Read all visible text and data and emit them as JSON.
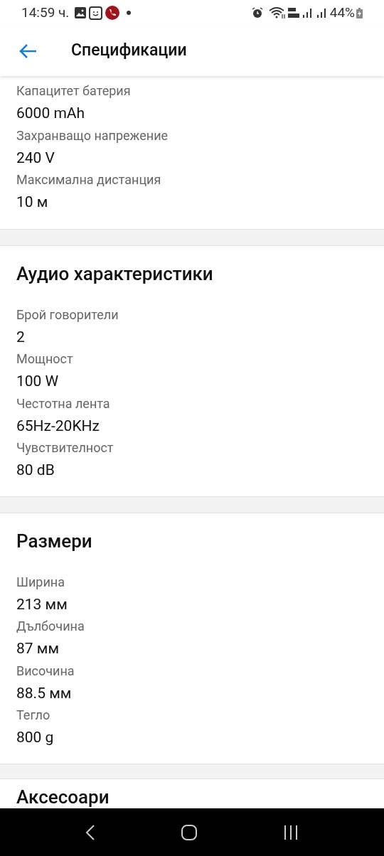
{
  "status_bar": {
    "time": "14:59 ч.",
    "battery": "44%"
  },
  "header": {
    "title": "Спецификации"
  },
  "sections": [
    {
      "specs": [
        {
          "label": "Капацитет батерия",
          "value": "6000 mAh"
        },
        {
          "label": "Захранващо напрежение",
          "value": "240 V"
        },
        {
          "label": "Максимална дистанция",
          "value": "10 м"
        }
      ]
    },
    {
      "title": "Аудио характеристики",
      "specs": [
        {
          "label": "Брой говорители",
          "value": "2"
        },
        {
          "label": "Мощност",
          "value": "100 W"
        },
        {
          "label": "Честотна лента",
          "value": "65Hz-20KHz"
        },
        {
          "label": "Чувствителност",
          "value": "80 dB"
        }
      ]
    },
    {
      "title": "Размери",
      "specs": [
        {
          "label": "Ширина",
          "value": "213 мм"
        },
        {
          "label": "Дълбочина",
          "value": "87 мм"
        },
        {
          "label": "Височина",
          "value": "88.5 мм"
        },
        {
          "label": "Тегло",
          "value": "800 g"
        }
      ]
    },
    {
      "title": "Аксесоари"
    }
  ]
}
